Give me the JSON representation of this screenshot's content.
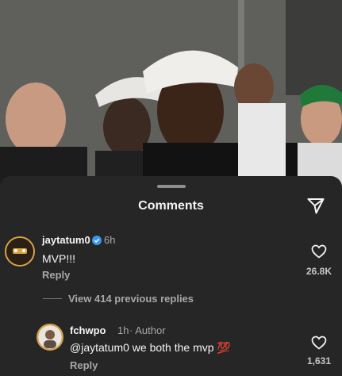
{
  "sheet": {
    "title": "Comments",
    "share_icon": "paper-plane-icon"
  },
  "comments": [
    {
      "username": "jaytatum0",
      "verified": true,
      "time": "6h",
      "text": "MVP!!!",
      "reply_label": "Reply",
      "likes": "26.8K"
    }
  ],
  "view_replies": "View 414 previous replies",
  "reply": {
    "username": "fchwpo",
    "time": "1h",
    "author_tag": "· Author",
    "text": "@jaytatum0 we both the mvp 💯",
    "reply_label": "Reply",
    "likes": "1,631"
  },
  "colors": {
    "sheet_bg": "#262626",
    "verified": "#3897f0",
    "muted_text": "#a8a8a8"
  }
}
